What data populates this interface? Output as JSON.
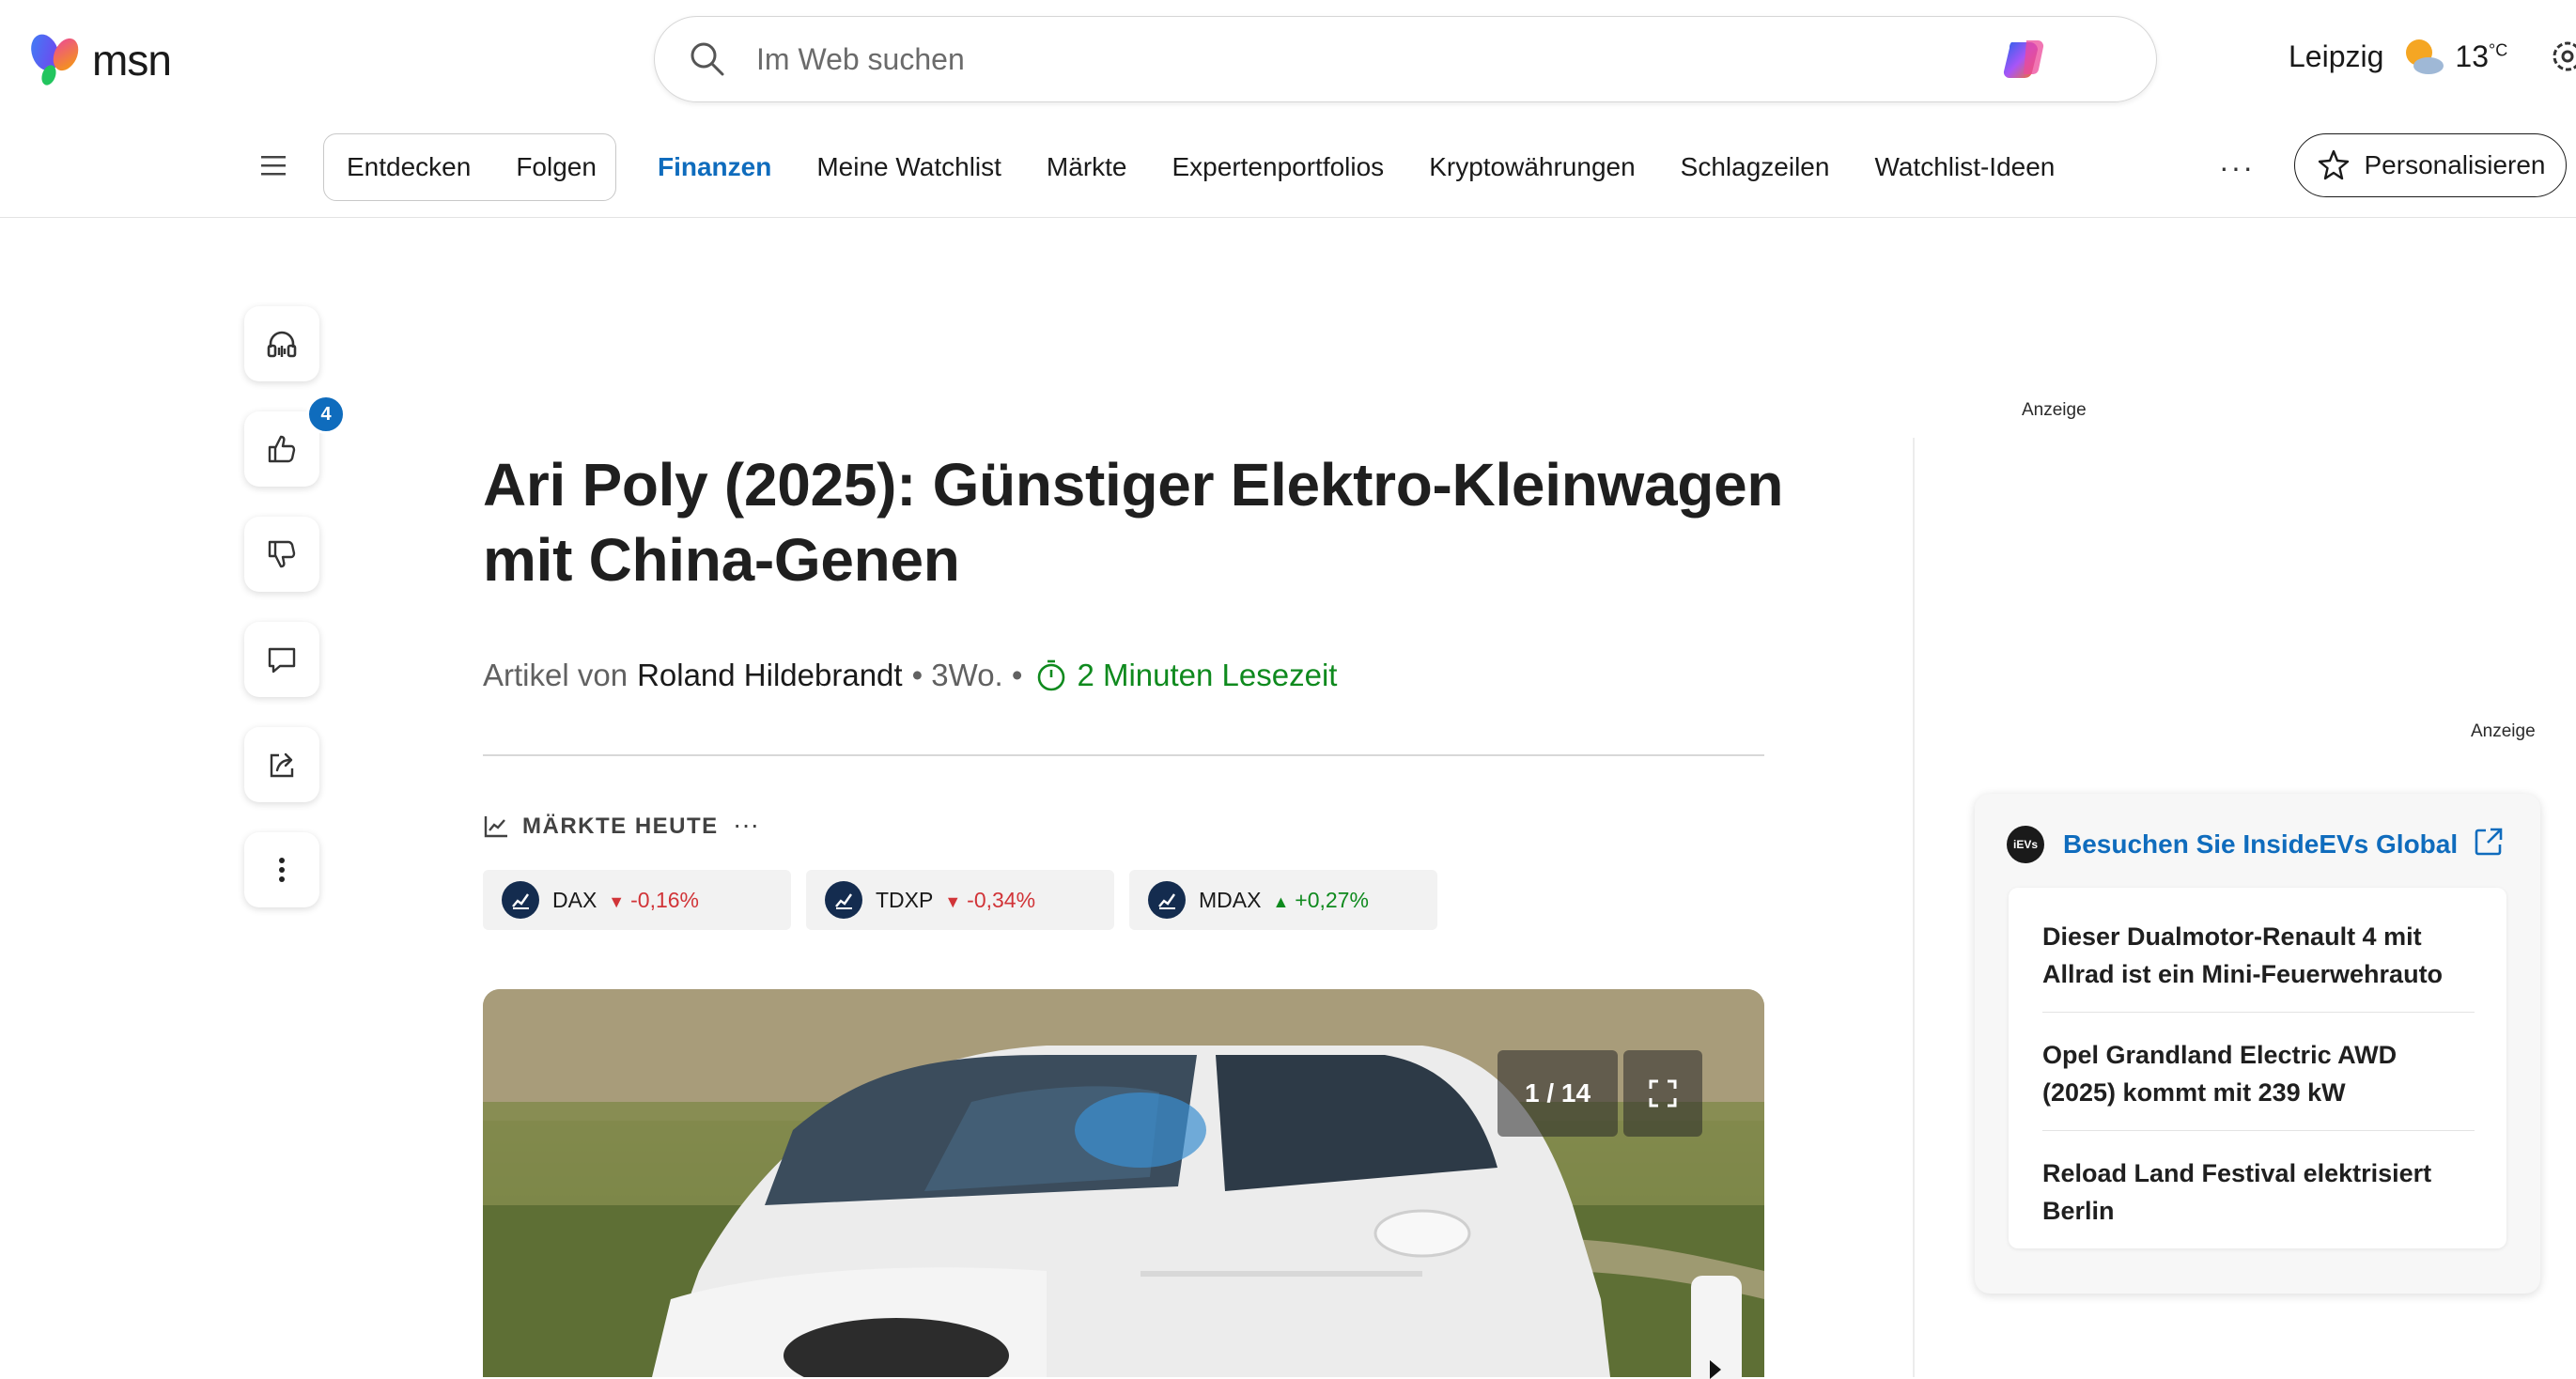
{
  "header": {
    "logo_text": "msn",
    "search_placeholder": "Im Web suchen",
    "weather": {
      "city": "Leipzig",
      "temperature": "13",
      "unit": "°C",
      "icon": "partly-cloudy-icon"
    }
  },
  "nav": {
    "pill_items": [
      {
        "label": "Entdecken"
      },
      {
        "label": "Folgen"
      }
    ],
    "items": [
      {
        "label": "Finanzen",
        "active": true
      },
      {
        "label": "Meine Watchlist"
      },
      {
        "label": "Märkte"
      },
      {
        "label": "Expertenportfolios"
      },
      {
        "label": "Kryptowährungen"
      },
      {
        "label": "Schlagzeilen"
      },
      {
        "label": "Watchlist-Ideen"
      }
    ],
    "more_label": "···",
    "personalize_label": "Personalisieren"
  },
  "rail": {
    "like_count": "4"
  },
  "article": {
    "title": "Ari Poly (2025): Günstiger Elektro-Kleinwagen mit China-Genen",
    "byline_prefix": "Artikel von",
    "author": "Roland Hildebrandt",
    "age": "• 3Wo. •",
    "read_time": "2 Minuten Lesezeit"
  },
  "markets": {
    "heading": "MÄRKTE HEUTE",
    "more": "···",
    "tickers": [
      {
        "name": "DAX",
        "change": "-0,16%",
        "direction": "down"
      },
      {
        "name": "TDXP",
        "change": "-0,34%",
        "direction": "down"
      },
      {
        "name": "MDAX",
        "change": "+0,27%",
        "direction": "up"
      }
    ]
  },
  "gallery": {
    "counter": "1 / 14"
  },
  "ads": {
    "label_top": "Anzeige",
    "label_right": "Anzeige"
  },
  "partner_card": {
    "logo_text": "iEVs",
    "title": "Besuchen Sie InsideEVs Global",
    "items": [
      {
        "text": "Dieser Dualmotor-Renault 4 mit Allrad ist ein Mini-Feuerwehrauto"
      },
      {
        "text": "Opel Grandland Electric AWD (2025) kommt mit 239 kW"
      },
      {
        "text": "Reload Land Festival elektrisiert Berlin"
      }
    ]
  },
  "colors": {
    "accent": "#0f6cbd",
    "down": "#d13438",
    "up": "#0f8a1e"
  }
}
